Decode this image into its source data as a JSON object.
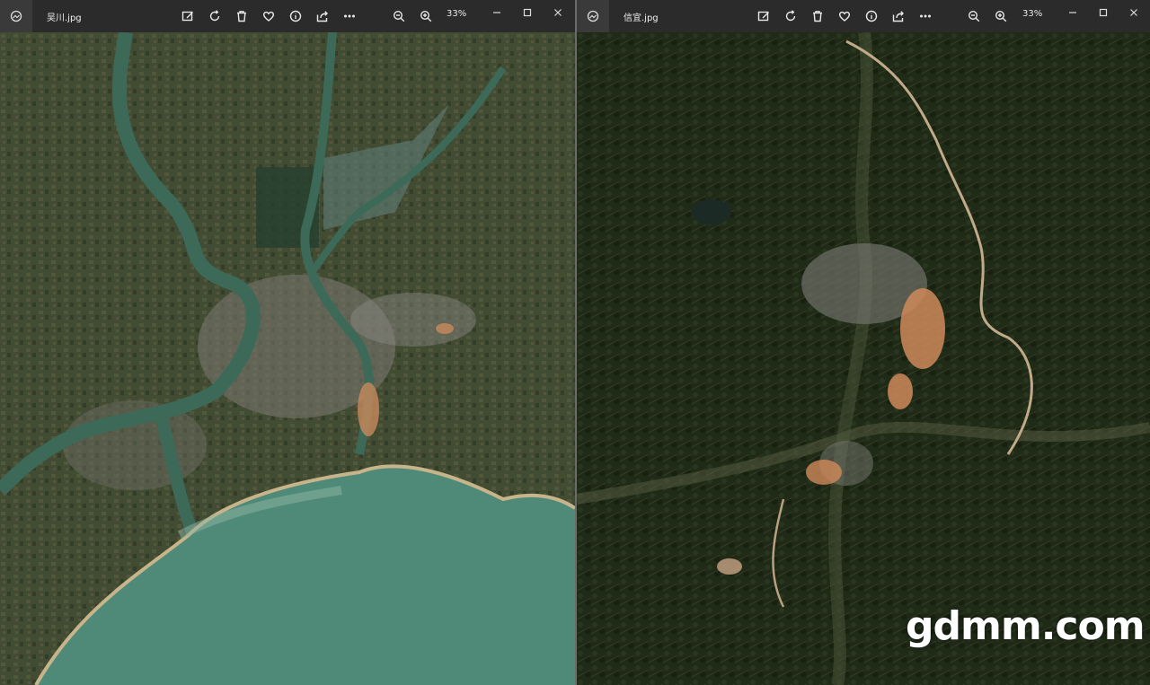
{
  "windows": [
    {
      "filename": "吴川.jpg",
      "zoom": "33%",
      "toolbar_icons": [
        "edit-image-icon",
        "rotate-icon",
        "delete-icon",
        "favorite-icon",
        "info-icon",
        "share-icon",
        "more-icon",
        "zoom-out-icon",
        "zoom-in-icon"
      ]
    },
    {
      "filename": "信宜.jpg",
      "zoom": "33%",
      "toolbar_icons": [
        "edit-image-icon",
        "rotate-icon",
        "delete-icon",
        "favorite-icon",
        "info-icon",
        "share-icon",
        "more-icon",
        "zoom-out-icon",
        "zoom-in-icon"
      ]
    }
  ],
  "watermark": "gdmm.com",
  "colors": {
    "titlebar": "#2b2b2b",
    "sea": "#4f8a78",
    "land_left": "#3f4a32",
    "forest_right": "#1f2a17",
    "bare_soil": "#d08a5a"
  }
}
